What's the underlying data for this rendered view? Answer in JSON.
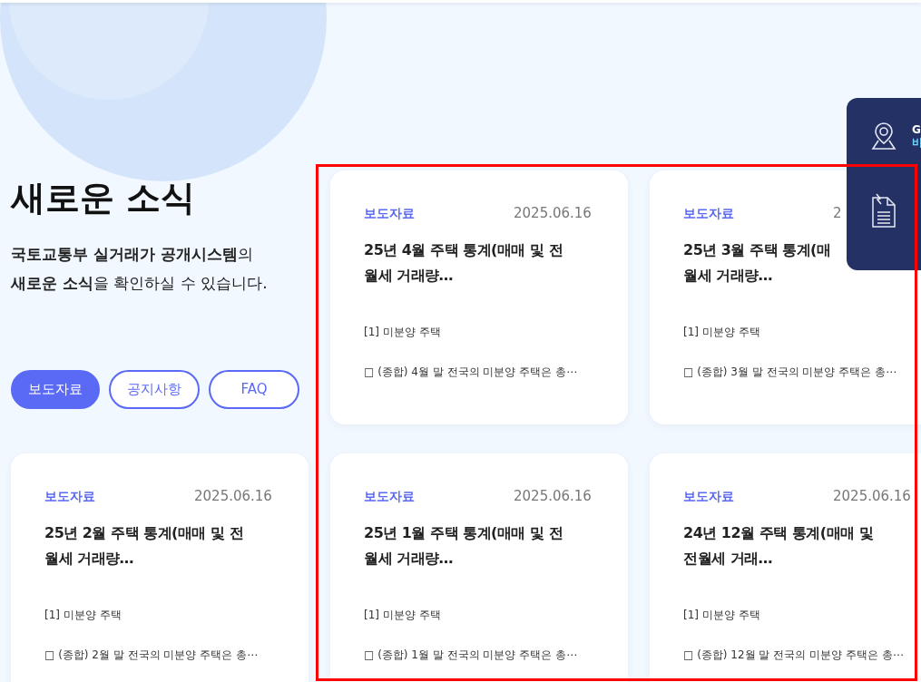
{
  "intro": {
    "title": "새로운 소식",
    "description": [
      "**국토교통부 실거래가 공개시스템**의",
      "**새로운 소식**을 확인하실 수 있습니다."
    ],
    "tabs": [
      {
        "label": "보도자료",
        "selected": true
      },
      {
        "label": "공지사항",
        "selected": false
      },
      {
        "label": "FAQ",
        "selected": false
      }
    ]
  },
  "cards": [
    {
      "category": "보도자료",
      "date": "2025.06.16",
      "title_lines": [
        "25년 4월 주택 통계(매매 및 전",
        "월세 거래량…"
      ],
      "subtitle": "[1] 미분양 주택",
      "summary": "□ (종합) 4월 말 전국의 미분양 주택은 총⋯"
    },
    {
      "category": "보도자료",
      "date": "2",
      "title_lines": [
        "25년 3월 주택 통계(매",
        "월세 거래량…"
      ],
      "subtitle": "[1] 미분양 주택",
      "summary": "□ (종합) 3월 말 전국의 미분양 주택은 총⋯"
    },
    {
      "category": "보도자료",
      "date": "2025.06.16",
      "title_lines": [
        "25년 2월 주택 통계(매매 및 전",
        "월세 거래량…"
      ],
      "subtitle": "[1] 미분양 주택",
      "summary": "□ (종합) 2월 말 전국의 미분양 주택은 총⋯"
    },
    {
      "category": "보도자료",
      "date": "2025.06.16",
      "title_lines": [
        "25년 1월 주택 통계(매매 및 전",
        "월세 거래량…"
      ],
      "subtitle": "[1] 미분양 주택",
      "summary": "□ (종합) 1월 말 전국의 미분양 주택은 총⋯"
    },
    {
      "category": "보도자료",
      "date": "2025.06.16",
      "title_lines": [
        "24년 12월 주택 통계(매매 및",
        "전월세 거래…"
      ],
      "subtitle": "[1] 미분양 주택",
      "summary": "□ (종합) 12월 말 전국의 미분양 주택은 총⋯"
    }
  ],
  "quick_menu": [
    {
      "kind": "pin",
      "label": "G",
      "sublabel": "비"
    },
    {
      "kind": "document"
    }
  ]
}
